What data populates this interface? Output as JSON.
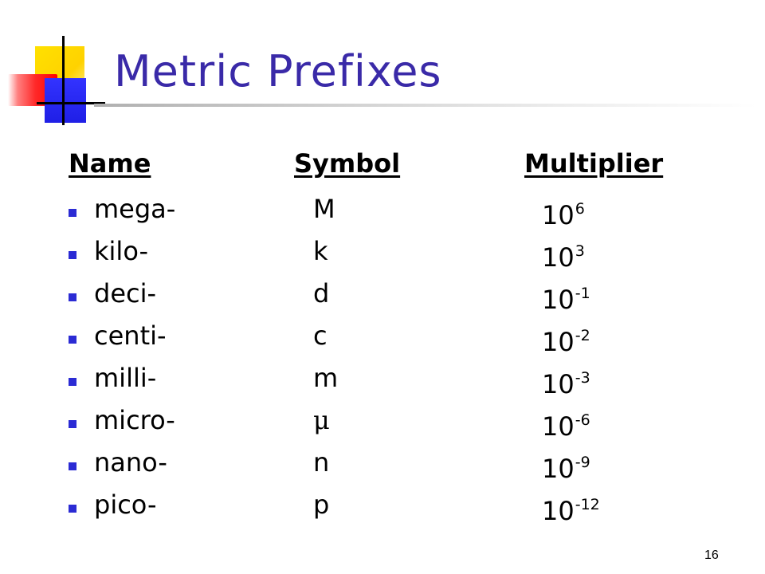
{
  "slide": {
    "title": "Metric Prefixes",
    "page_number": "16"
  },
  "colors": {
    "title": "#3a2aa8",
    "bullet": "#2b2bd4",
    "logo_yellow": "#ffd200",
    "logo_red": "#ff0000",
    "logo_blue": "#2020e8"
  },
  "table": {
    "headers": {
      "name": "Name",
      "symbol": "Symbol",
      "multiplier": "Multiplier"
    },
    "rows": [
      {
        "name": "mega-",
        "symbol": "M",
        "base": "10",
        "exponent": "6"
      },
      {
        "name": "kilo-",
        "symbol": "k",
        "base": "10",
        "exponent": "3"
      },
      {
        "name": "deci-",
        "symbol": "d",
        "base": "10",
        "exponent": "-1"
      },
      {
        "name": "centi-",
        "symbol": "c",
        "base": "10",
        "exponent": "-2"
      },
      {
        "name": "milli-",
        "symbol": "m",
        "base": "10",
        "exponent": "-3"
      },
      {
        "name": "micro-",
        "symbol": "μ",
        "base": "10",
        "exponent": "-6"
      },
      {
        "name": "nano-",
        "symbol": "n",
        "base": "10",
        "exponent": "-9"
      },
      {
        "name": "pico-",
        "symbol": "p",
        "base": "10",
        "exponent": "-12"
      }
    ]
  }
}
